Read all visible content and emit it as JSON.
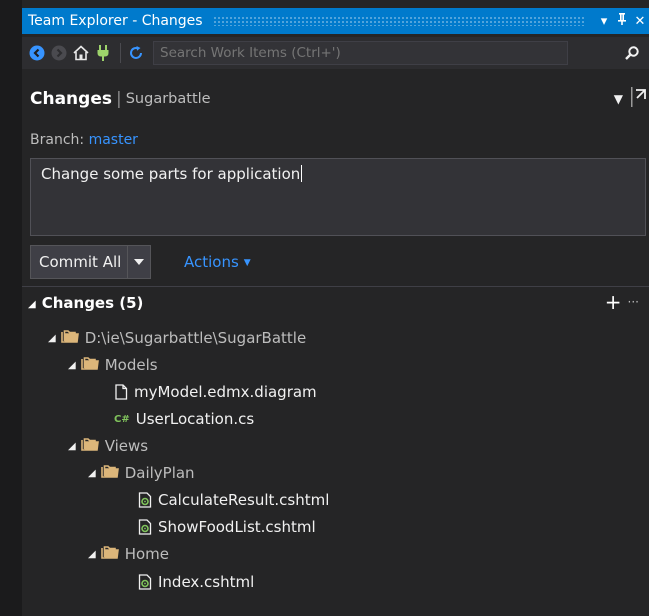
{
  "window": {
    "title": "Team Explorer - Changes"
  },
  "toolbar": {
    "search_placeholder": "Search Work Items (Ctrl+')"
  },
  "header": {
    "title": "Changes",
    "separator": "|",
    "project": "Sugarbattle"
  },
  "branch": {
    "label": "Branch:",
    "name": "master"
  },
  "commit_message": "Change some parts for application",
  "commit_button": "Commit All",
  "actions_label": "Actions",
  "changes_section": {
    "label": "Changes (5)"
  },
  "tree": {
    "root": "D:\\ie\\Sugarbattle\\SugarBattle",
    "models": "Models",
    "model_file1": "myModel.edmx.diagram",
    "model_file2": "UserLocation.cs",
    "views": "Views",
    "dailyplan": "DailyPlan",
    "dp_file1": "CalculateResult.cshtml",
    "dp_file2": "ShowFoodList.cshtml",
    "home": "Home",
    "home_file1": "Index.cshtml"
  },
  "colors": {
    "accent": "#007acc",
    "link": "#3794ff",
    "background": "#252526"
  }
}
